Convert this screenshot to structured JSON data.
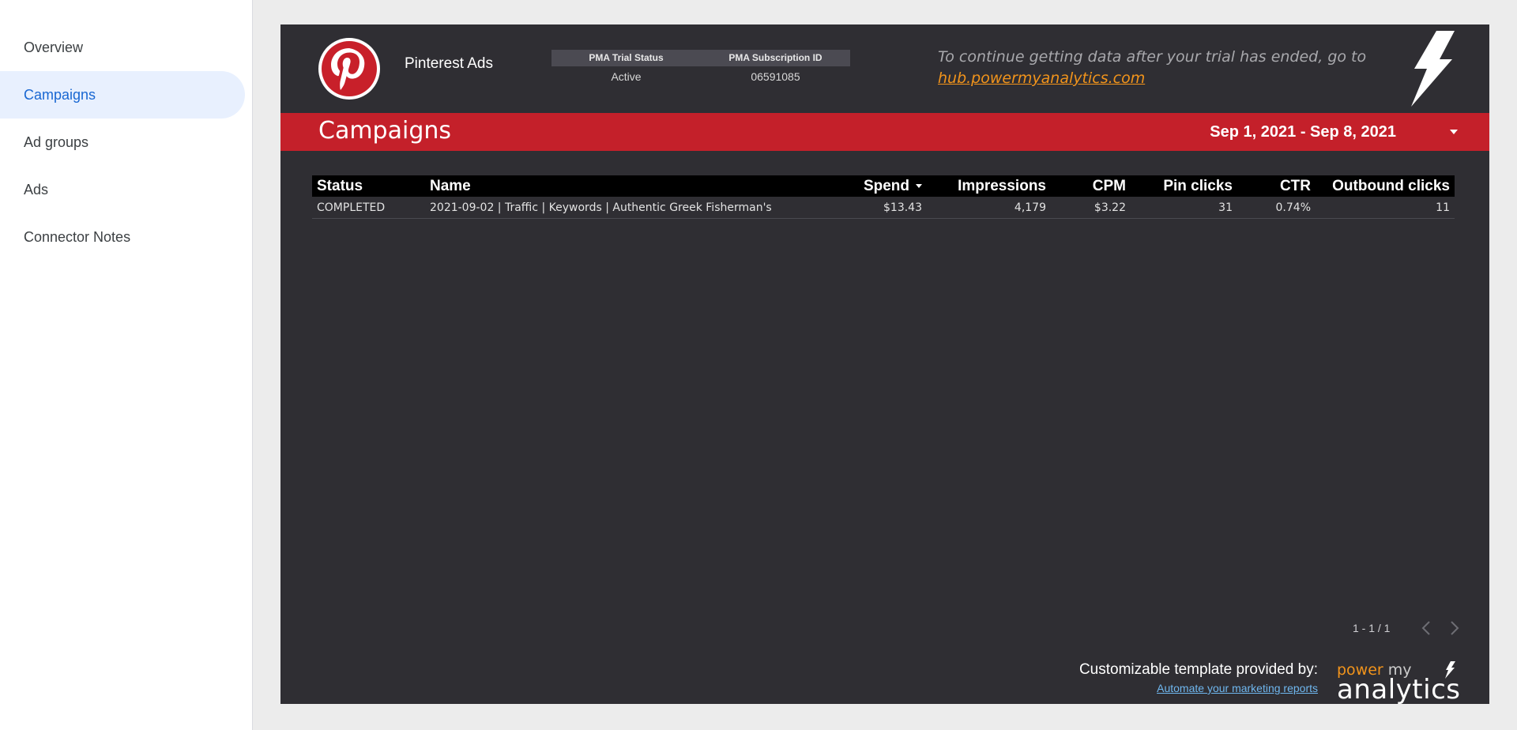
{
  "sidebar": {
    "items": [
      {
        "label": "Overview",
        "active": false
      },
      {
        "label": "Campaigns",
        "active": true
      },
      {
        "label": "Ad groups",
        "active": false
      },
      {
        "label": "Ads",
        "active": false
      },
      {
        "label": "Connector Notes",
        "active": false
      }
    ]
  },
  "header": {
    "app_name": "Pinterest Ads",
    "logo_icon": "pinterest-logo-icon",
    "pma_table": {
      "headers": [
        "PMA Trial Status",
        "PMA Subscription ID"
      ],
      "values": [
        "Active",
        "06591085"
      ]
    },
    "notice_text": "To continue getting data after your trial has ended, go to",
    "notice_link": "hub.powermyanalytics.com",
    "bolt_icon": "lightning-bolt-icon"
  },
  "title_bar": {
    "title": "Campaigns",
    "date_range": "Sep 1, 2021 - Sep 8, 2021"
  },
  "table": {
    "columns": [
      "Status",
      "Name",
      "Spend",
      "Impressions",
      "CPM",
      "Pin clicks",
      "CTR",
      "Outbound clicks"
    ],
    "sorted_by": "Spend",
    "rows": [
      {
        "status": "COMPLETED",
        "name": "2021-09-02 | Traffic | Keywords | Authentic Greek Fisherman's",
        "spend": "$13.43",
        "impressions": "4,179",
        "cpm": "$3.22",
        "pin_clicks": "31",
        "ctr": "0.74%",
        "outbound_clicks": "11"
      }
    ]
  },
  "pager": {
    "text": "1 - 1 / 1"
  },
  "footer": {
    "main": "Customizable template provided by:",
    "link": "Automate your marketing reports",
    "brand_power": "power",
    "brand_my": "my",
    "brand_analytics": "analytics"
  },
  "colors": {
    "canvas": "#2f2e33",
    "title_bar": "#c4202a",
    "accent_orange": "#f2941b",
    "sidebar_active_bg": "#e8f0fe",
    "sidebar_active_text": "#1967d2"
  }
}
